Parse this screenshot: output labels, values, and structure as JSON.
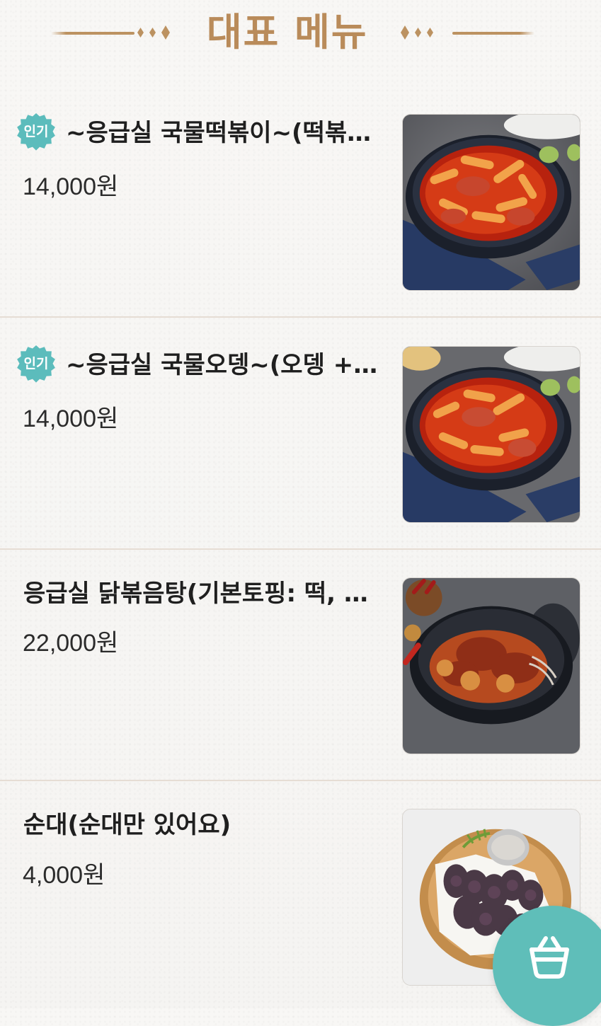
{
  "header": {
    "title": "대표 메뉴"
  },
  "menu": {
    "items": [
      {
        "badge": "인기",
        "name": "~응급실 국물떡볶이~(떡볶이 떡 + 어묵)",
        "price": "14,000원",
        "image": "tteokbokki-bowl-photo"
      },
      {
        "badge": "인기",
        "name": "~응급실 국물오뎅~(오뎅 + 떡볶이 떡)",
        "price": "14,000원",
        "image": "oden-tteokbokki-bowl-photo"
      },
      {
        "badge": "",
        "name": "응급실 닭볶음탕(기본토핑: 떡, 당면)",
        "price": "22,000원",
        "image": "braised-spicy-chicken-photo"
      },
      {
        "badge": "",
        "name": "순대(순대만 있어요)",
        "price": "4,000원",
        "image": "sundae-plate-photo"
      }
    ]
  },
  "cart": {
    "icon": "shopping-basket-icon",
    "color": "#5fbeb9"
  },
  "colors": {
    "title": "#b98b5a",
    "badge": "#5cbcbc",
    "divider": "#e6ddd4"
  }
}
